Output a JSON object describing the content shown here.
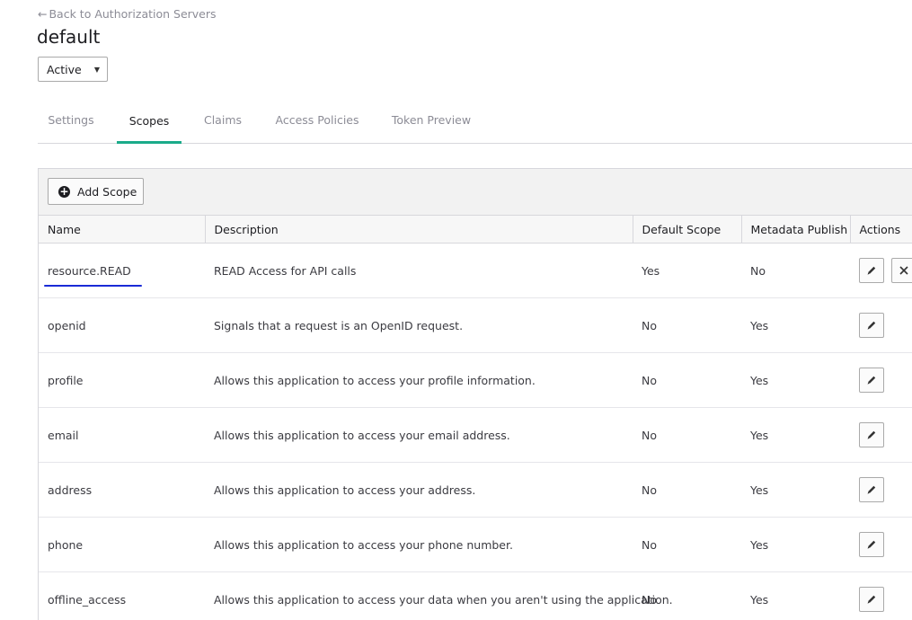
{
  "back_link": {
    "arrow": "←",
    "label": "Back to Authorization Servers"
  },
  "page_title": "default",
  "status_select": {
    "value": "Active"
  },
  "tabs": [
    {
      "label": "Settings",
      "active": false
    },
    {
      "label": "Scopes",
      "active": true
    },
    {
      "label": "Claims",
      "active": false
    },
    {
      "label": "Access Policies",
      "active": false
    },
    {
      "label": "Token Preview",
      "active": false
    }
  ],
  "toolbar": {
    "add_label": "Add Scope"
  },
  "table": {
    "columns": [
      "Name",
      "Description",
      "Default Scope",
      "Metadata Publish",
      "Actions"
    ],
    "rows": [
      {
        "name": "resource.READ",
        "description": "READ Access for API calls",
        "default_scope": "Yes",
        "metadata_publish": "No",
        "deletable": true
      },
      {
        "name": "openid",
        "description": "Signals that a request is an OpenID request.",
        "default_scope": "No",
        "metadata_publish": "Yes",
        "deletable": false
      },
      {
        "name": "profile",
        "description": "Allows this application to access your profile information.",
        "default_scope": "No",
        "metadata_publish": "Yes",
        "deletable": false
      },
      {
        "name": "email",
        "description": "Allows this application to access your email address.",
        "default_scope": "No",
        "metadata_publish": "Yes",
        "deletable": false
      },
      {
        "name": "address",
        "description": "Allows this application to access your address.",
        "default_scope": "No",
        "metadata_publish": "Yes",
        "deletable": false
      },
      {
        "name": "phone",
        "description": "Allows this application to access your phone number.",
        "default_scope": "No",
        "metadata_publish": "Yes",
        "deletable": false
      },
      {
        "name": "offline_access",
        "description": "Allows this application to access your data when you aren't using the application.",
        "default_scope": "No",
        "metadata_publish": "Yes",
        "deletable": false
      }
    ]
  },
  "colors": {
    "accent": "#1aab8a",
    "highlight_underline": "#1a2bd6",
    "border": "#d7d7dc",
    "muted_text": "#8c8c96"
  },
  "icons": {
    "edit": "pencil-icon",
    "delete": "close-icon",
    "add": "plus-circle-icon",
    "dropdown": "caret-down-icon"
  }
}
